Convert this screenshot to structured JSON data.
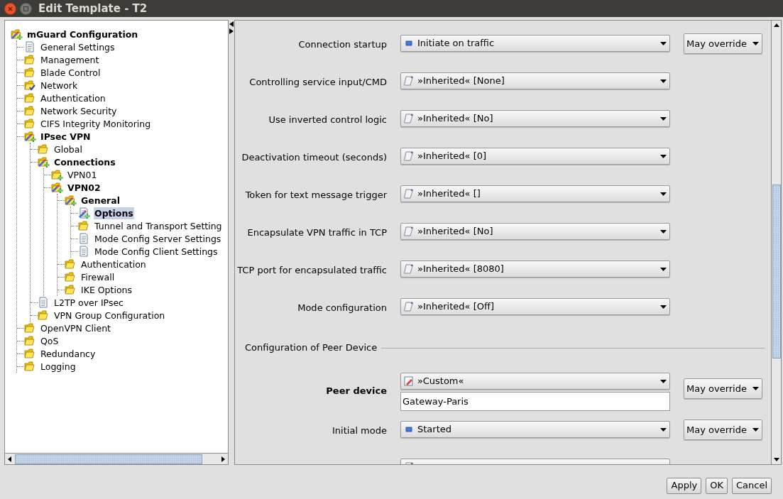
{
  "window": {
    "title": "Edit Template - T2"
  },
  "tree": [
    {
      "label": "mGuard Configuration",
      "kind": "folder-edit",
      "bold": true,
      "selected": false,
      "children": [
        {
          "label": "General Settings",
          "kind": "document",
          "bold": false,
          "selected": false
        },
        {
          "label": "Management",
          "kind": "folder",
          "bold": false,
          "selected": false
        },
        {
          "label": "Blade Control",
          "kind": "folder",
          "bold": false,
          "selected": false
        },
        {
          "label": "Network",
          "kind": "folder-checked",
          "bold": false,
          "selected": false
        },
        {
          "label": "Authentication",
          "kind": "folder",
          "bold": false,
          "selected": false
        },
        {
          "label": "Network Security",
          "kind": "folder",
          "bold": false,
          "selected": false
        },
        {
          "label": "CIFS Integrity Monitoring",
          "kind": "folder",
          "bold": false,
          "selected": false
        },
        {
          "label": "IPsec VPN",
          "kind": "folder-edit",
          "bold": true,
          "selected": false,
          "children": [
            {
              "label": "Global",
              "kind": "folder",
              "bold": false,
              "selected": false
            },
            {
              "label": "Connections",
              "kind": "folder-edit",
              "bold": true,
              "selected": false,
              "children": [
                {
                  "label": "VPN01",
                  "kind": "folder-added",
                  "bold": false,
                  "selected": false
                },
                {
                  "label": "VPN02",
                  "kind": "folder-edit",
                  "bold": true,
                  "selected": false,
                  "children": [
                    {
                      "label": "General",
                      "kind": "folder-edit",
                      "bold": true,
                      "selected": false,
                      "children": [
                        {
                          "label": "Options",
                          "kind": "document-edit",
                          "bold": true,
                          "selected": true
                        },
                        {
                          "label": "Tunnel and Transport Setting",
                          "kind": "folder",
                          "bold": false,
                          "selected": false
                        },
                        {
                          "label": "Mode Config Server Settings",
                          "kind": "document",
                          "bold": false,
                          "selected": false
                        },
                        {
                          "label": "Mode Config Client Settings",
                          "kind": "document",
                          "bold": false,
                          "selected": false
                        }
                      ]
                    },
                    {
                      "label": "Authentication",
                      "kind": "folder",
                      "bold": false,
                      "selected": false
                    },
                    {
                      "label": "Firewall",
                      "kind": "folder",
                      "bold": false,
                      "selected": false
                    },
                    {
                      "label": "IKE Options",
                      "kind": "folder",
                      "bold": false,
                      "selected": false
                    }
                  ]
                }
              ]
            },
            {
              "label": "L2TP over IPsec",
              "kind": "document",
              "bold": false,
              "selected": false
            },
            {
              "label": "VPN Group Configuration",
              "kind": "folder",
              "bold": false,
              "selected": false
            }
          ]
        },
        {
          "label": "OpenVPN Client",
          "kind": "folder",
          "bold": false,
          "selected": false
        },
        {
          "label": "QoS",
          "kind": "folder",
          "bold": false,
          "selected": false
        },
        {
          "label": "Redundancy",
          "kind": "folder",
          "bold": false,
          "selected": false
        },
        {
          "label": "Logging",
          "kind": "folder",
          "bold": false,
          "selected": false
        }
      ]
    }
  ],
  "form": [
    {
      "kind": "combo",
      "label": "Connection startup",
      "bold": false,
      "value": {
        "text": "Initiate on traffic",
        "kind": "square"
      },
      "override": "May override"
    },
    {
      "kind": "combo",
      "label": "Controlling service input/CMD",
      "bold": false,
      "value": {
        "text": "»Inherited« [None]",
        "kind": "scroll"
      }
    },
    {
      "kind": "combo",
      "label": "Use inverted control logic",
      "bold": false,
      "value": {
        "text": "»Inherited« [No]",
        "kind": "scroll"
      }
    },
    {
      "kind": "combo",
      "label": "Deactivation timeout (seconds)",
      "bold": false,
      "value": {
        "text": "»Inherited« [0]",
        "kind": "scroll"
      }
    },
    {
      "kind": "combo",
      "label": "Token for text message trigger",
      "bold": false,
      "value": {
        "text": "»Inherited« []",
        "kind": "scroll"
      }
    },
    {
      "kind": "combo",
      "label": "Encapsulate VPN traffic in TCP",
      "bold": false,
      "value": {
        "text": "»Inherited« [No]",
        "kind": "scroll"
      }
    },
    {
      "kind": "combo",
      "label": "TCP port for encapsulated traffic",
      "bold": false,
      "value": {
        "text": "»Inherited« [8080]",
        "kind": "scroll"
      }
    },
    {
      "kind": "combo",
      "label": "Mode configuration",
      "bold": false,
      "value": {
        "text": "»Inherited« [Off]",
        "kind": "scroll"
      }
    },
    {
      "kind": "section",
      "label": "Configuration of Peer Device"
    },
    {
      "kind": "combo_text",
      "label": "Peer device",
      "bold": true,
      "value": {
        "text": "»Custom«",
        "kind": "note"
      },
      "text": "Gateway-Paris",
      "override": "May override"
    },
    {
      "kind": "combo",
      "label": "Initial mode",
      "bold": false,
      "value": {
        "text": "Started",
        "kind": "square"
      },
      "override": "May override"
    },
    {
      "kind": "combo",
      "value": {
        "kind": "scroll"
      }
    }
  ],
  "buttons": [
    "Apply",
    "OK",
    "Cancel"
  ]
}
